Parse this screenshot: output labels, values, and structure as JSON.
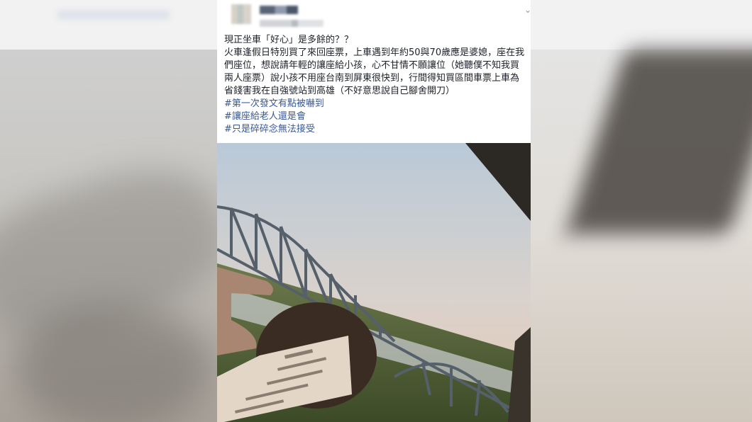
{
  "post": {
    "author": "",
    "meta": "",
    "title": "現正坐車「好心」是多餘的？？",
    "body": "火車逢假日特別買了來回座票，上車遇到年約50與70歲應是婆媳，座在我們座位，想說請年輕的讓座給小孩，心不甘情不願讓位（她聽僕不知我買兩人座票）說小孩不用座台南到屏東很快到，行間得知買區間車票上車為省錢害我在自強號站到高雄（不好意思說自己腳舍開刀）",
    "hashtags": [
      "#第一次發文有點被嚇到",
      "#讓座給老人還是會",
      "#只是碎碎念無法接受"
    ]
  },
  "icons": {
    "options": "chevron-down-icon"
  }
}
